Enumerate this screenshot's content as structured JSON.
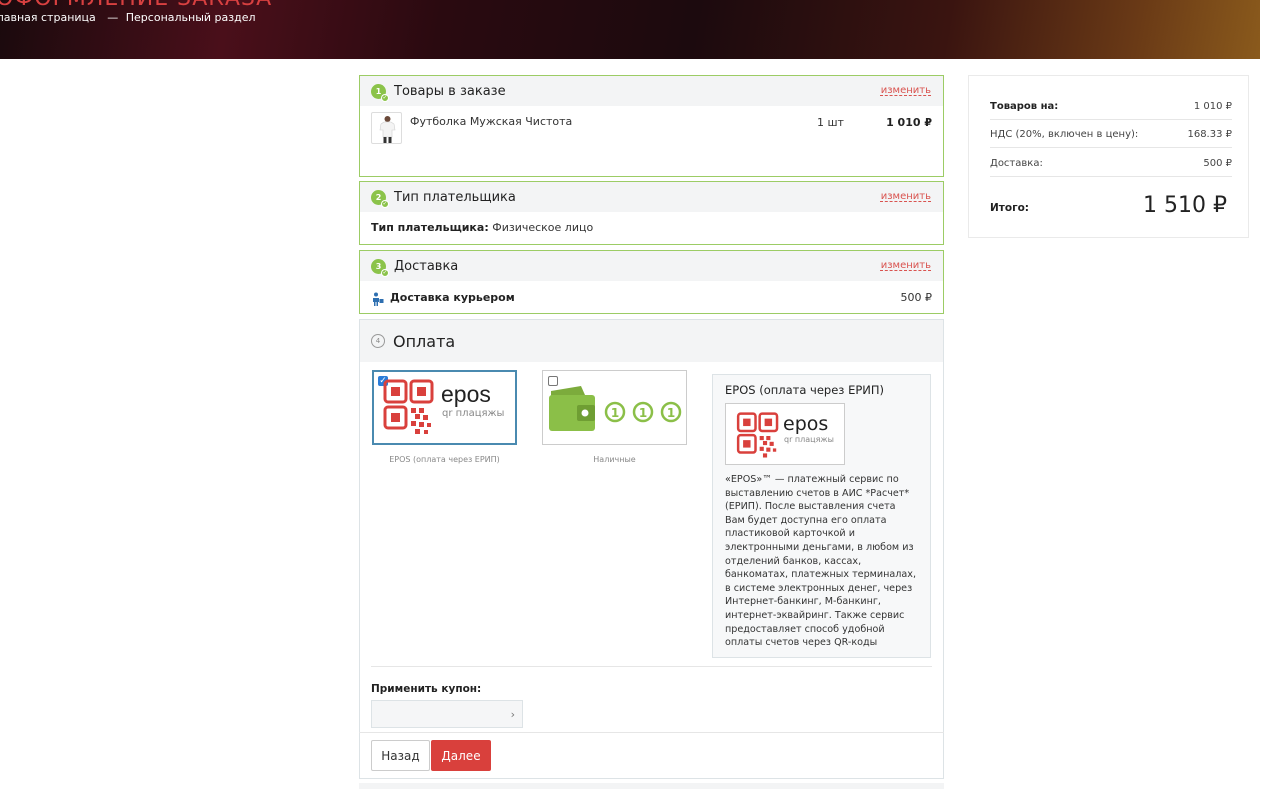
{
  "header": {
    "title": "ОФОРМЛЕНИЕ ЗАКАЗА",
    "breadcrumbs": [
      "Главная страница",
      "—",
      "Персональный раздел"
    ]
  },
  "steps": {
    "edit_label": "изменить",
    "items": {
      "num": "1",
      "title": "Товары в заказе",
      "product": {
        "name": "Футболка Мужская Чистота",
        "qty": "1 шт",
        "price": "1 010 ₽"
      }
    },
    "payer": {
      "num": "2",
      "title": "Тип плательщика",
      "label": "Тип плательщика:",
      "value": "Физическое лицо"
    },
    "delivery": {
      "num": "3",
      "title": "Доставка",
      "method": "Доставка курьером",
      "price": "500 ₽"
    },
    "payment": {
      "num": "4",
      "title": "Оплата",
      "methods": [
        {
          "label": "EPOS (оплата через ЕРИП)",
          "selected": true,
          "logo_word": "epos",
          "logo_sub": "qr плацяжы"
        },
        {
          "label": "Наличные",
          "selected": false
        }
      ],
      "desc_title": "EPOS (оплата через ЕРИП)",
      "desc_text": "«EPOS»™ — платежный сервис по выставлению счетов в АИС *Расчет* (ЕРИП). После выставления счета Вам будет доступна его оплата пластиковой карточкой и электронными деньгами, в любом из отделений банков, кассах, банкоматах, платежных терминалах, в системе электронных денег, через Интернет-банкинг, М-банкинг, интернет-эквайринг. Также сервис предоставляет способ удобной оплаты счетов через QR-коды",
      "coupon_label": "Применить купон:",
      "coupon_value": "",
      "back_label": "Назад",
      "next_label": "Далее"
    }
  },
  "summary": {
    "rows": [
      {
        "k": "Товаров на:",
        "v": "1 010 ₽"
      },
      {
        "k": "НДС (20%, включен в цену):",
        "v": "168.33 ₽"
      },
      {
        "k": "Доставка:",
        "v": "500 ₽"
      }
    ],
    "total_label": "Итого:",
    "total_value": "1 510 ₽"
  },
  "colors": {
    "accent_red": "#d9403c",
    "step_green": "#8bc34a",
    "selected_blue": "#4a8ab0"
  }
}
